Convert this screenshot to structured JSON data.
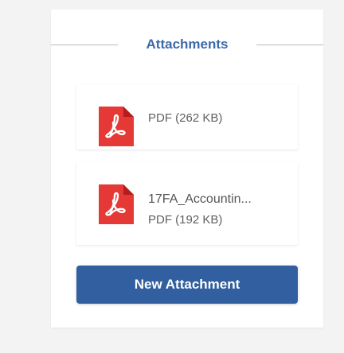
{
  "header": {
    "title": "Attachments"
  },
  "attachments": [
    {
      "name": "",
      "type_size": "PDF (262 KB)",
      "icon": "pdf-file-icon"
    },
    {
      "name": "17FA_Accountin...",
      "type_size": "PDF (192 KB)",
      "icon": "pdf-file-icon"
    }
  ],
  "actions": {
    "new_attachment_label": "New Attachment"
  },
  "colors": {
    "accent": "#315f9f",
    "title": "#3d6aa8",
    "pdf_red": "#e53935"
  }
}
